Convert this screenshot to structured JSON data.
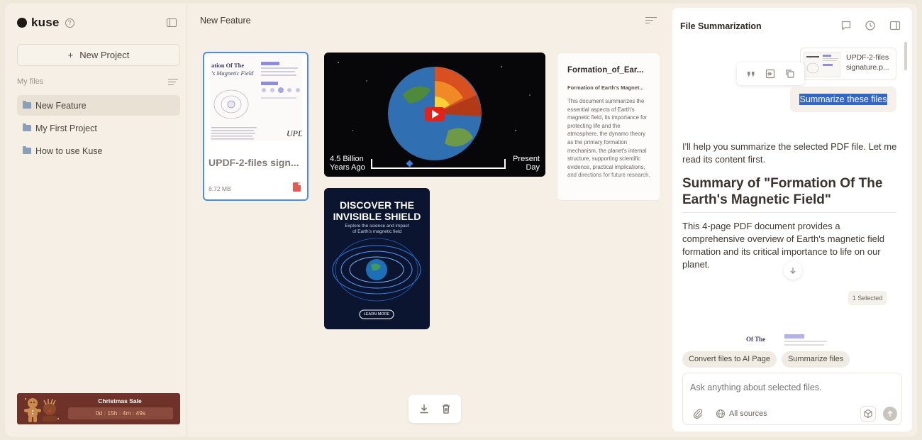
{
  "sidebar": {
    "logo": "kuse",
    "help": "?",
    "new_project": "New Project",
    "my_files_label": "My files",
    "folders": [
      {
        "label": "New Feature"
      },
      {
        "label": "My First Project"
      },
      {
        "label": "How to use Kuse"
      }
    ],
    "promo": {
      "title": "Christmas Sale",
      "timer": "0d : 15h : 4m : 49s"
    }
  },
  "main": {
    "title": "New Feature",
    "pdf_card": {
      "name": "UPDF-2-files sign...",
      "size": "8.72 MB",
      "thumb_title_line1": "ation Of The",
      "thumb_title_line2": "'s Magnetic Field",
      "signature": "UPD"
    },
    "video_card": {
      "left_caption_line1": "4.5 Billion",
      "left_caption_line2": "Years Ago",
      "right_caption_line1": "Present",
      "right_caption_line2": "Day"
    },
    "poster_card": {
      "title_line1": "DISCOVER THE",
      "title_line2": "INVISIBLE SHIELD",
      "subtitle_line1": "Explore the science and impact",
      "subtitle_line2": "of Earth's magnetic field",
      "button": "LEARN MORE"
    },
    "doc_card": {
      "title": "Formation_of_Ear...",
      "subtitle": "Formation of Earth's Magnet...",
      "body": "This document summarizes the essential aspects of Earth's magnetic field, its importance for protecting life and the atmosphere, the dynamo theory as the primary formation mechanism, the planet's internal structure, supporting scientific evidence, practical implications, and directions for future research."
    }
  },
  "panel": {
    "title": "File Summarization",
    "file_chip": {
      "line1": "UPDF-2-files",
      "line2": "signature.p..."
    },
    "user_message": "Summarize these files",
    "ai_intro": "I'll help you summarize the selected PDF file. Let me read its content first.",
    "ai_heading": "Summary of \"Formation Of The Earth's Magnetic Field\"",
    "ai_body": "This 4-page PDF document provides a comprehensive overview of Earth's magnetic field formation and its critical importance to life on our planet.",
    "selected_badge": "1 Selected",
    "mini_preview_title": "Of The",
    "suggestions": [
      "Convert files to AI Page",
      "Summarize files"
    ],
    "input_placeholder": "Ask anything about selected files.",
    "sources_label": "All sources"
  },
  "colors": {
    "accent_blue": "#4a8fe8",
    "highlight": "#3466c4",
    "promo_bg": "#6e3228",
    "pdf_red": "#e25c52"
  }
}
